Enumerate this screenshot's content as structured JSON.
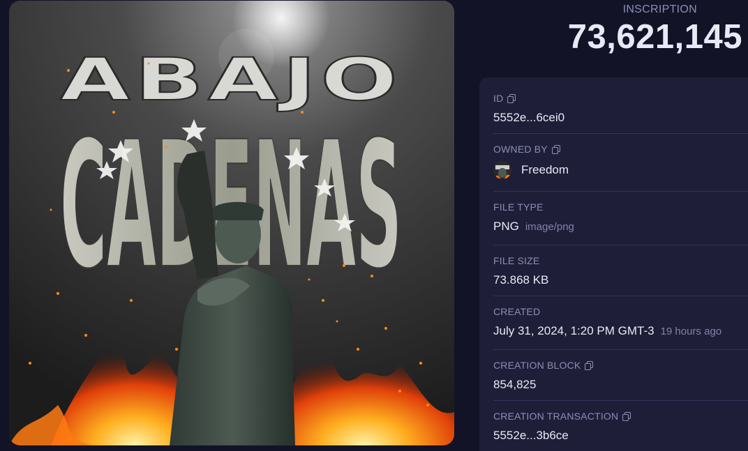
{
  "header": {
    "label": "INSCRIPTION",
    "number": "73,621,145"
  },
  "artwork": {
    "title_line1": "ABAJO",
    "title_line2": "CADENAS"
  },
  "details": {
    "id": {
      "label": "ID",
      "value": "5552e...6cei0"
    },
    "owner": {
      "label": "OWNED BY",
      "value": "Freedom"
    },
    "file_type": {
      "label": "FILE TYPE",
      "value": "PNG",
      "mime": "image/png"
    },
    "file_size": {
      "label": "FILE SIZE",
      "value": "73.868 KB"
    },
    "created": {
      "label": "CREATED",
      "value": "July 31, 2024, 1:20 PM GMT-3",
      "relative": "19 hours ago"
    },
    "creation_block": {
      "label": "CREATION BLOCK",
      "value": "854,825"
    },
    "creation_transaction": {
      "label": "CREATION TRANSACTION",
      "value": "5552e...3b6ce"
    }
  },
  "colors": {
    "background": "#131327",
    "card": "#1f1e38",
    "label": "#8a8fb4",
    "text": "#e7e9f6",
    "divider": "#34335a"
  }
}
